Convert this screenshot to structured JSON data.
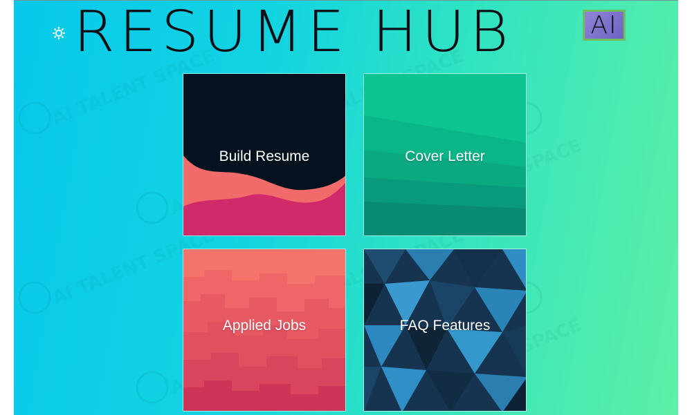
{
  "header": {
    "logo_text": "RESUME HUB",
    "ai_badge": "AI",
    "settings_icon": "gear-icon"
  },
  "watermark": {
    "text": "AI TALENT SPACE"
  },
  "tiles": [
    {
      "label": "Build Resume"
    },
    {
      "label": "Cover Letter"
    },
    {
      "label": "Applied Jobs"
    },
    {
      "label": "FAQ Features"
    }
  ],
  "colors": {
    "background_start": "#08c8ea",
    "background_end": "#5ef0a6",
    "build_resume_dark": "#04121f",
    "build_resume_coral": "#f26b6b",
    "build_resume_magenta": "#d12a6a",
    "cover_letter_green": "#0aa982",
    "applied_jobs_coral": "#f4736b",
    "faq_blue": "#2a7fb0"
  }
}
